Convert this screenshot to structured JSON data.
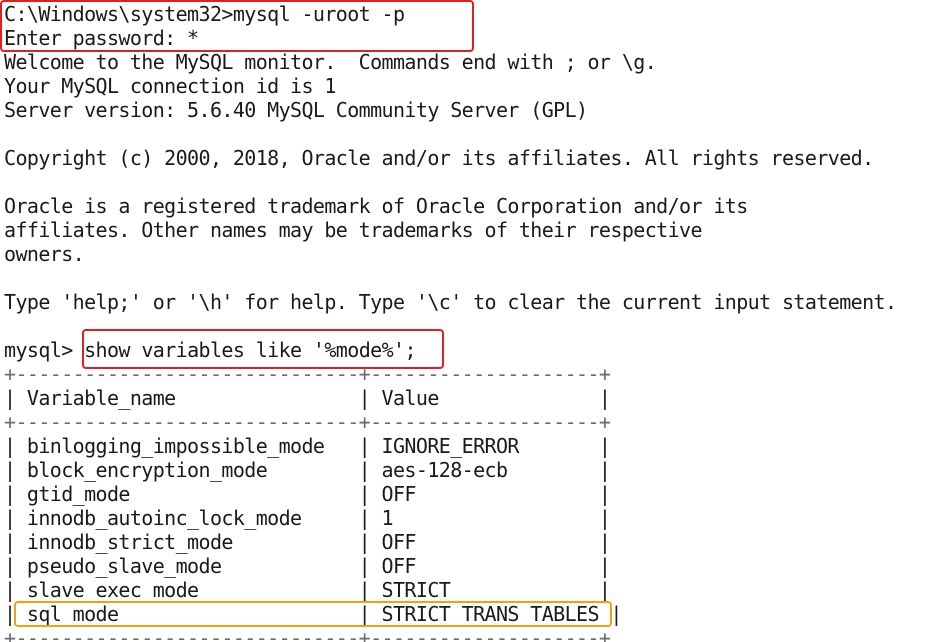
{
  "console": {
    "lines": [
      "C:\\Windows\\system32>mysql -uroot -p",
      "Enter password: *",
      "Welcome to the MySQL monitor.  Commands end with ; or \\g.",
      "Your MySQL connection id is 1",
      "Server version: 5.6.40 MySQL Community Server (GPL)",
      "",
      "Copyright (c) 2000, 2018, Oracle and/or its affiliates. All rights reserved.",
      "",
      "Oracle is a registered trademark of Oracle Corporation and/or its",
      "affiliates. Other names may be trademarks of their respective",
      "owners.",
      "",
      "Type 'help;' or '\\h' for help. Type '\\c' to clear the current input statement.",
      ""
    ],
    "prompt": "mysql>",
    "query": "show variables like '%mode%';"
  },
  "table": {
    "separator": "+------------------------------+--------------------+",
    "header_line": "| Variable_name                | Value              |",
    "columns": [
      "Variable_name",
      "Value"
    ],
    "rows": [
      {
        "line": "| binlogging_impossible_mode   | IGNORE_ERROR       |",
        "name": "binlogging_impossible_mode",
        "value": "IGNORE_ERROR"
      },
      {
        "line": "| block_encryption_mode        | aes-128-ecb        |",
        "name": "block_encryption_mode",
        "value": "aes-128-ecb"
      },
      {
        "line": "| gtid_mode                    | OFF                |",
        "name": "gtid_mode",
        "value": "OFF"
      },
      {
        "line": "| innodb_autoinc_lock_mode     | 1                  |",
        "name": "innodb_autoinc_lock_mode",
        "value": "1"
      },
      {
        "line": "| innodb_strict_mode           | OFF                |",
        "name": "innodb_strict_mode",
        "value": "OFF"
      },
      {
        "line": "| pseudo_slave_mode            | OFF                |",
        "name": "pseudo_slave_mode",
        "value": "OFF"
      },
      {
        "line": "| slave_exec_mode              | STRICT             |",
        "name": "slave_exec_mode",
        "value": "STRICT"
      },
      {
        "line": "| sql_mode                     | STRICT_TRANS_TABLES |",
        "name": "sql_mode",
        "value": "STRICT_TRANS_TABLES"
      }
    ]
  },
  "highlight_colors": {
    "red": "#e02020",
    "gold": "#f2a20f"
  }
}
